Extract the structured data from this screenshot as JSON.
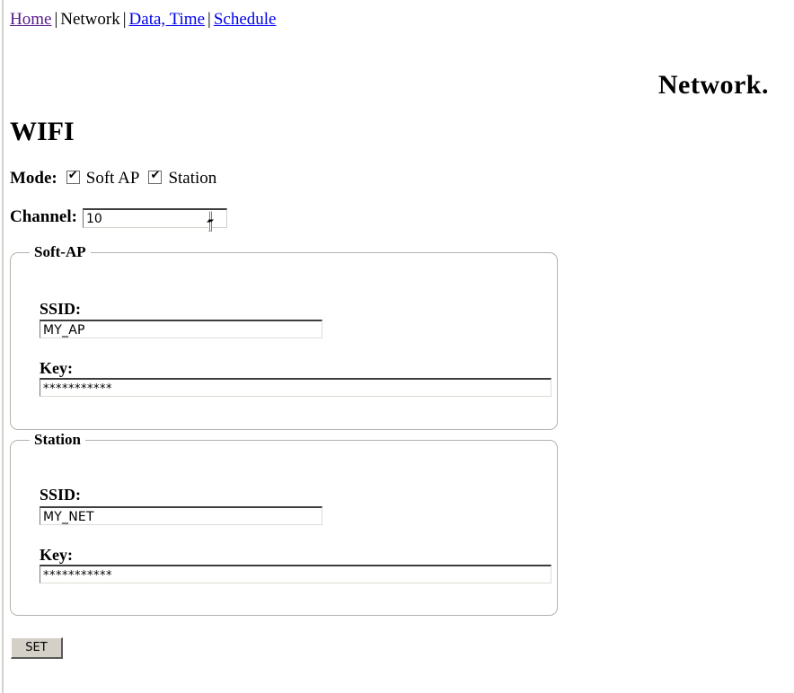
{
  "nav": {
    "items": [
      {
        "label": "Home",
        "state": "visited"
      },
      {
        "label": "Network",
        "state": "current"
      },
      {
        "label": "Data, Time",
        "state": "link"
      },
      {
        "label": "Schedule",
        "state": "link"
      }
    ],
    "separator": "|"
  },
  "header": {
    "page_title": "Network."
  },
  "wifi": {
    "heading": "WIFI",
    "mode": {
      "label": "Mode:",
      "options": [
        {
          "label": "Soft AP",
          "checked": true,
          "glyph": "✔"
        },
        {
          "label": "Station",
          "checked": true,
          "glyph": "✔"
        }
      ]
    },
    "channel": {
      "label": "Channel:",
      "value": "10",
      "spinner_up": "spinner-up-arrow",
      "spinner_down": "spinner-down-arrow"
    },
    "soft_ap": {
      "legend": "Soft-AP",
      "ssid_label": "SSID:",
      "ssid_value": "MY_AP",
      "key_label": "Key:",
      "key_value": "***********"
    },
    "station": {
      "legend": "Station",
      "ssid_label": "SSID:",
      "ssid_value": "MY_NET",
      "key_label": "Key:",
      "key_value": "***********"
    }
  },
  "actions": {
    "set_label": "SET"
  },
  "colors": {
    "visited_link": "#551a8b",
    "link": "#0000ee",
    "text": "#000000",
    "button_face": "#d4d0c8",
    "fieldset_border": "#b4b4ae",
    "page_background": "#ffffff"
  }
}
